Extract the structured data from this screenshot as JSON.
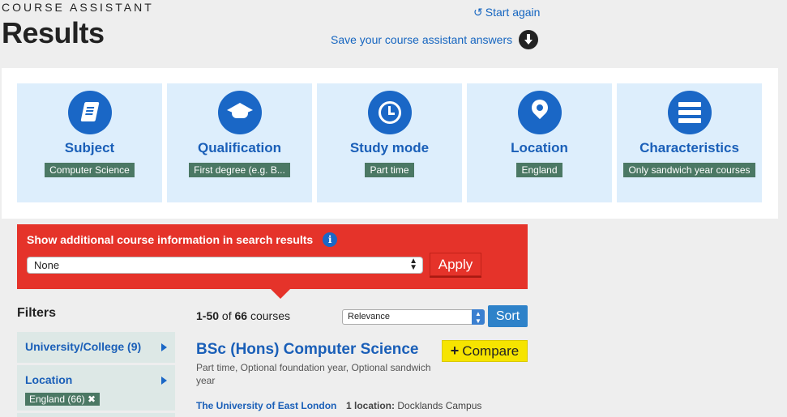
{
  "header": {
    "kicker": "COURSE ASSISTANT",
    "title": "Results",
    "start_again": "Start again",
    "save_answers": "Save your course assistant answers"
  },
  "criteria": [
    {
      "label": "Subject",
      "value": "Computer Science",
      "icon": "book-icon"
    },
    {
      "label": "Qualification",
      "value": "First degree (e.g. B...",
      "icon": "graduation-cap-icon"
    },
    {
      "label": "Study mode",
      "value": "Part time",
      "icon": "clock-icon"
    },
    {
      "label": "Location",
      "value": "England",
      "icon": "location-pin-icon"
    },
    {
      "label": "Characteristics",
      "value": "Only sandwich year courses",
      "icon": "list-bars-icon"
    }
  ],
  "info_box": {
    "title": "Show additional course information in search results",
    "select_value": "None",
    "apply_label": "Apply"
  },
  "filters": {
    "title": "Filters",
    "items": [
      {
        "label": "University/College (9)"
      },
      {
        "label": "Location",
        "tag": "England (66) ✖"
      }
    ]
  },
  "results": {
    "range": "1-50",
    "of": "of",
    "total": "66",
    "unit": "courses",
    "sort_value": "Relevance",
    "sort_label": "Sort"
  },
  "course": {
    "title": "BSc (Hons) Computer Science",
    "compare_label": "Compare",
    "description": "Part time, Optional foundation year, Optional sandwich year",
    "university": "The University of East London",
    "location_count": "1 location:",
    "location_name": "Docklands Campus"
  },
  "colors": {
    "accent_blue": "#1a67c6",
    "tile_bg": "#ddeefc",
    "chip_green": "#4b7864",
    "info_red": "#e5332a",
    "compare_yellow": "#f6e400"
  }
}
